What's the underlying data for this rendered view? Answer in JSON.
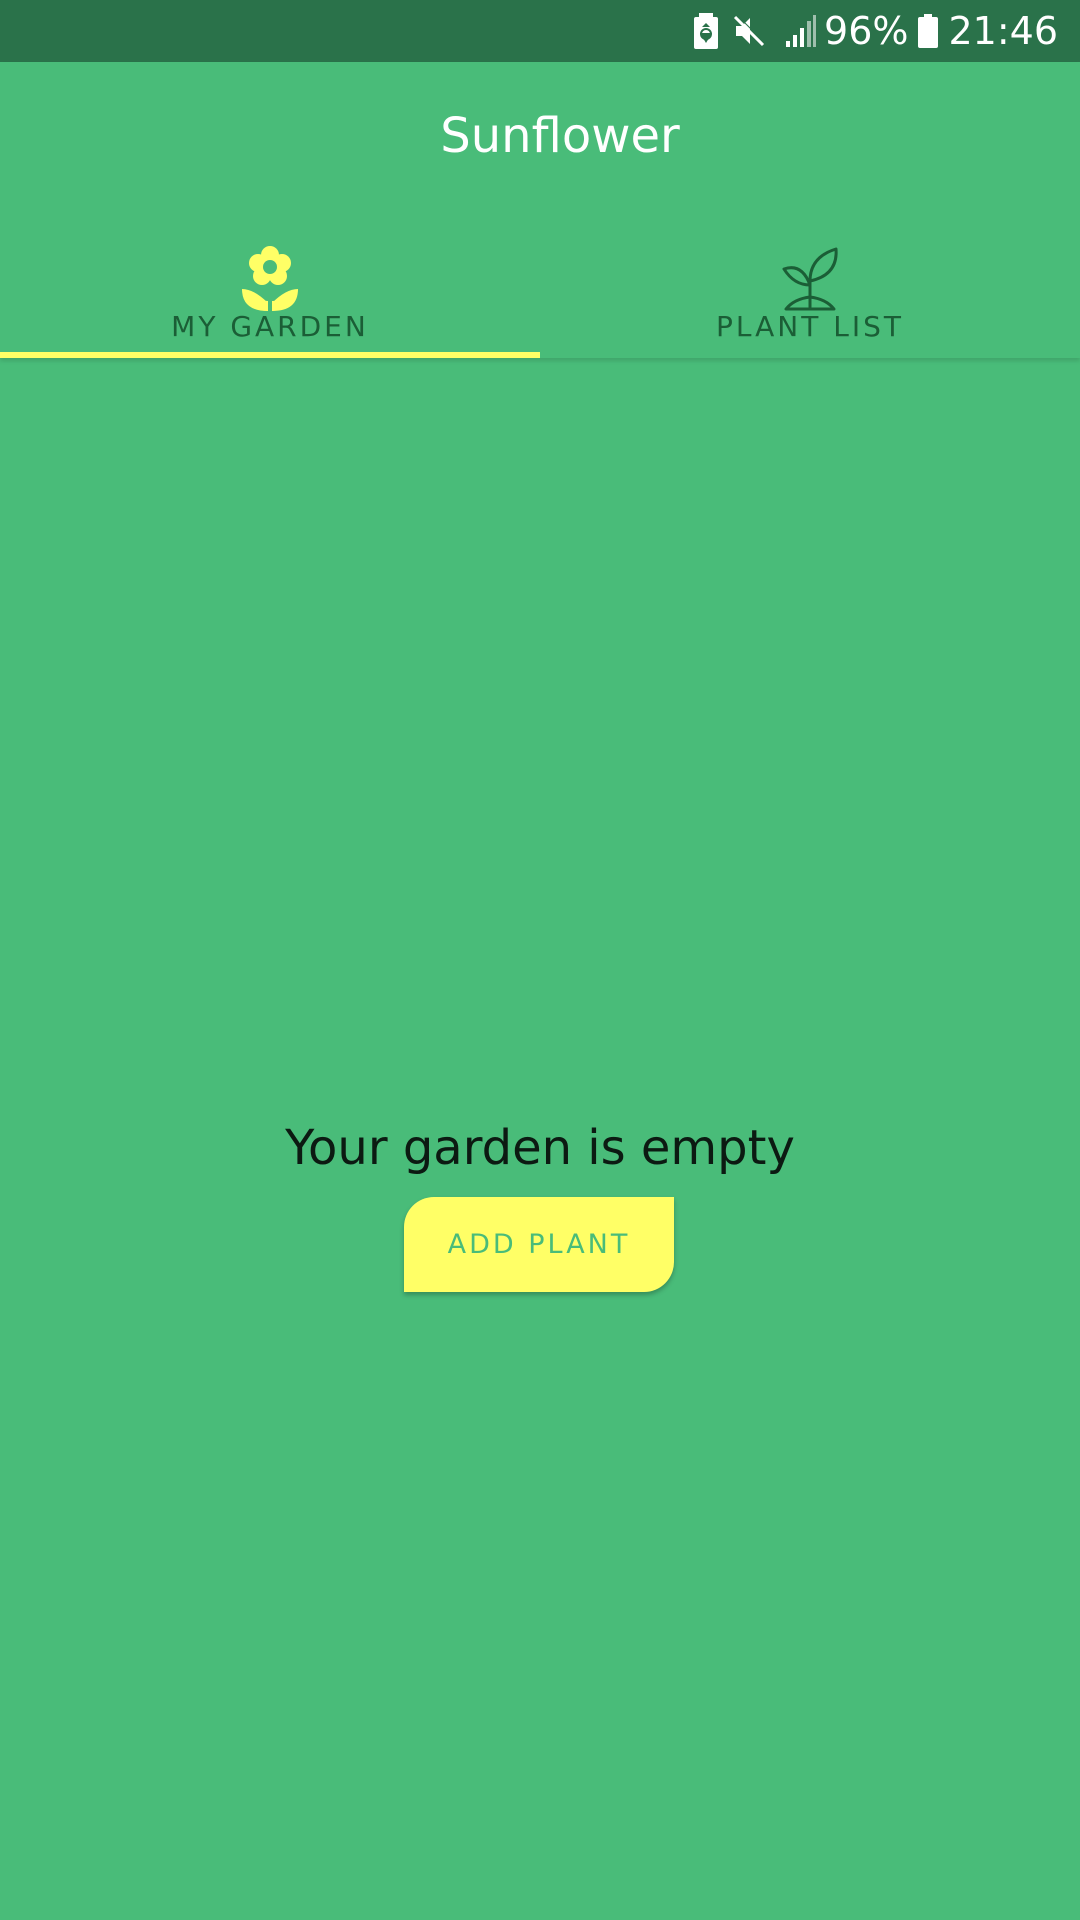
{
  "status_bar": {
    "battery_percent": "96%",
    "time": "21:46",
    "icons": [
      "battery-saver-icon",
      "mute-icon",
      "signal-icon",
      "battery-icon"
    ]
  },
  "app_bar": {
    "title": "Sunflower"
  },
  "tabs": [
    {
      "label": "MY GARDEN",
      "icon": "flower-icon",
      "selected": true
    },
    {
      "label": "PLANT LIST",
      "icon": "sprout-icon",
      "selected": false
    }
  ],
  "main": {
    "empty_message": "Your garden is empty",
    "add_button_label": "ADD PLANT"
  },
  "colors": {
    "background": "#49bc79",
    "status_bar": "#2a724a",
    "accent": "#ffff66",
    "tab_text": "#1b5e36"
  }
}
